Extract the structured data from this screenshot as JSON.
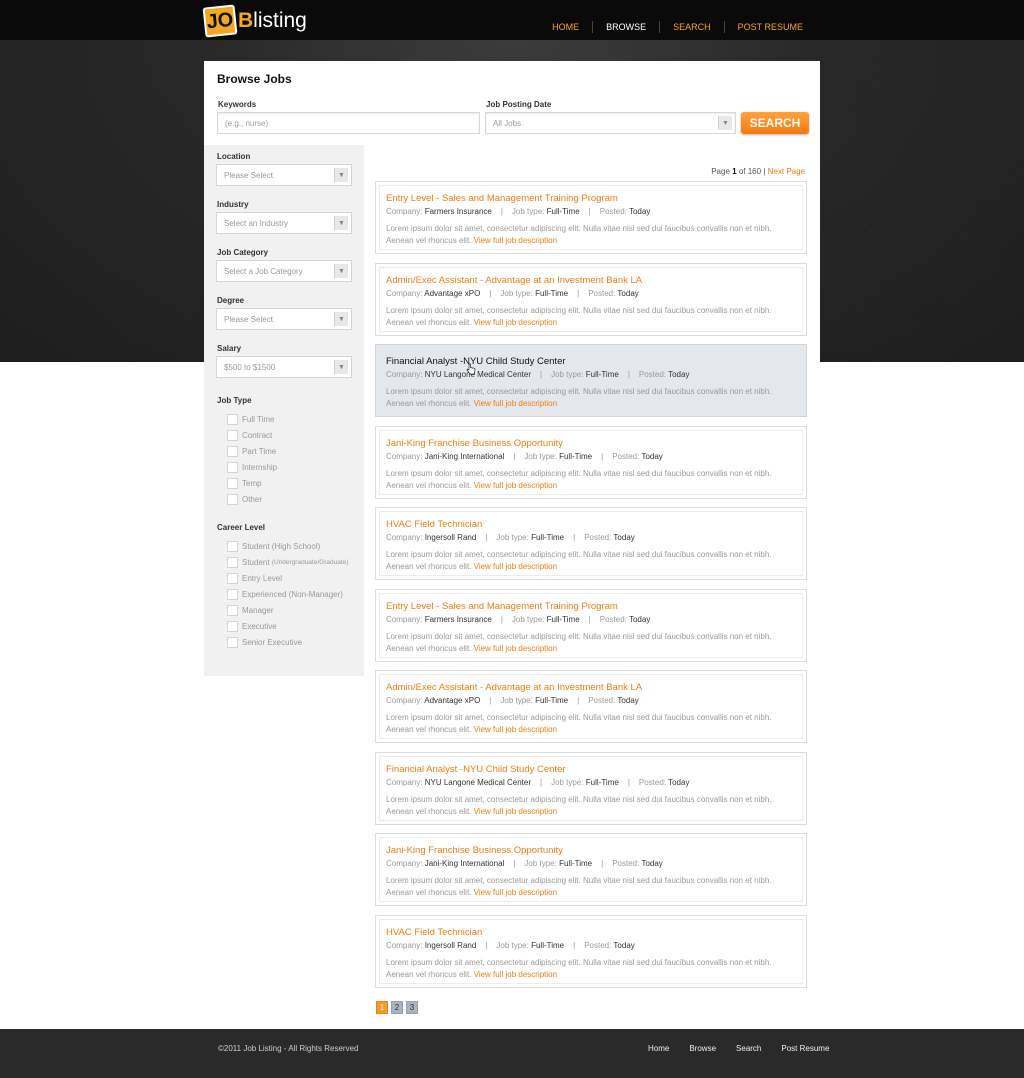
{
  "header": {
    "logo_badge": "JO",
    "logo_b": "B",
    "logo_word": "listing",
    "nav": [
      "HOME",
      "BROWSE",
      "SEARCH",
      "POST RESUME"
    ]
  },
  "browse": {
    "title": "Browse Jobs",
    "keywords_label": "Keywords",
    "keywords_placeholder": "(e.g., nurse)",
    "date_label": "Job Posting Date",
    "date_value": "All Jobs",
    "search_button": "SEARCH"
  },
  "sidebar": {
    "location_label": "Location",
    "location_value": "Please Select",
    "industry_label": "Industry",
    "industry_value": "Select an Industry",
    "category_label": "Job Category",
    "category_value": "Select a Job Category",
    "degree_label": "Degree",
    "degree_value": "Please Select",
    "salary_label": "Salary",
    "salary_value": "$500 to $1500",
    "job_type_label": "Job Type",
    "job_types": [
      "Full Time",
      "Contract",
      "Part Time",
      "Internship",
      "Temp",
      "Other"
    ],
    "career_label": "Career Level",
    "career_levels": [
      "Student (High School)",
      "Student",
      "Entry Level",
      "Experienced (Non-Manager)",
      "Manager",
      "Executive",
      "Senior Executive"
    ],
    "career_student_suffix": "(Undergraduate/Graduate)"
  },
  "pagination_top": {
    "page_word": "Page",
    "current": "1",
    "of_word": "of",
    "total": "160",
    "separator": "|",
    "next": "Next Page"
  },
  "job_labels": {
    "company": "Company:",
    "job_type": "Job type:",
    "posted": "Posted:",
    "sep": "|",
    "more": "View full job description"
  },
  "job_description": "Lorem ipsum dolor sit amet, consectetur adipiscing elit. Nulla vitae nisl sed dui faucibus convallis non et nibh. Aenean vel rhoncus elit.",
  "jobs": [
    {
      "title": "Entry Level - Sales and Management Training Program",
      "company": "Farmers Insurance",
      "type": "Full-Time",
      "posted": "Today"
    },
    {
      "title": "Admin/Exec Assistant - Advantage at an Investment Bank LA",
      "company": "Advantage xPO",
      "type": "Full-Time",
      "posted": "Today"
    },
    {
      "title": "Financial Analyst -NYU Child Study Center",
      "company": "NYU Langone Medical Center",
      "type": "Full-Time",
      "posted": "Today"
    },
    {
      "title": "Jani-King Franchise Business Opportunity",
      "company": "Jani-King International",
      "type": "Full-Time",
      "posted": "Today"
    },
    {
      "title": "HVAC Field Technician",
      "company": "Ingersoll Rand",
      "type": "Full-Time",
      "posted": "Today"
    },
    {
      "title": "Entry Level - Sales and Management Training Program",
      "company": "Farmers Insurance",
      "type": "Full-Time",
      "posted": "Today"
    },
    {
      "title": "Admin/Exec Assistant - Advantage at an Investment Bank LA",
      "company": "Advantage xPO",
      "type": "Full-Time",
      "posted": "Today"
    },
    {
      "title": "Financial Analyst -NYU Child Study Center",
      "company": "NYU Langone Medical Center",
      "type": "Full-Time",
      "posted": "Today"
    },
    {
      "title": "Jani-King Franchise Business Opportunity",
      "company": "Jani-King International",
      "type": "Full-Time",
      "posted": "Today"
    },
    {
      "title": "HVAC Field Technician",
      "company": "Ingersoll Rand",
      "type": "Full-Time",
      "posted": "Today"
    }
  ],
  "pages": [
    "1",
    "2",
    "3"
  ],
  "footer": {
    "copyright": "©2011 Job Listing - All Rights Reserved",
    "links": [
      "Home",
      "Browse",
      "Search",
      "Post Resume"
    ]
  },
  "colors": {
    "accent": "#f07d13",
    "logo": "#f5a623",
    "dark": "#0a0a0a",
    "footer": "#2a2a2a",
    "highlight_row": "#e4e7ec"
  },
  "icons": {
    "select_arrow": "chevron-down-icon",
    "cursor": "hand-pointer-icon"
  }
}
